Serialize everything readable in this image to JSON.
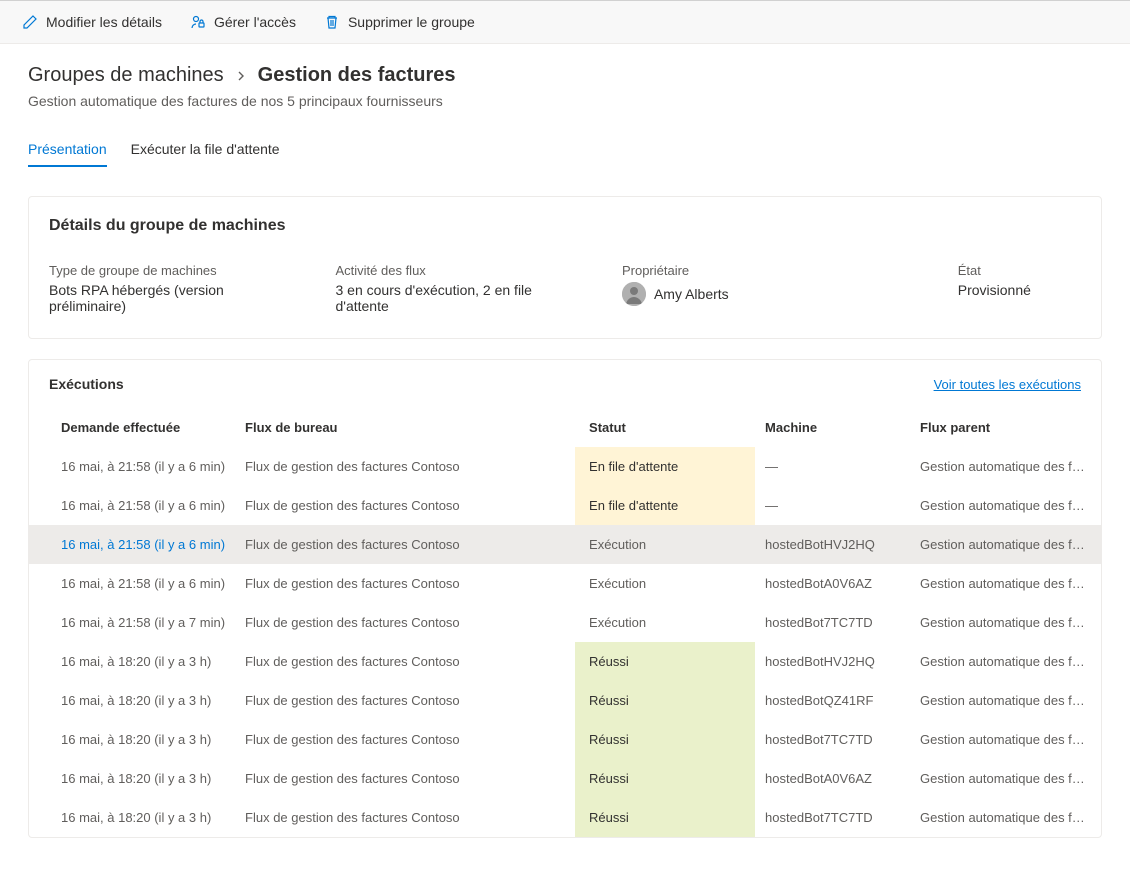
{
  "toolbar": {
    "edit_label": "Modifier les détails",
    "manage_access_label": "Gérer l'accès",
    "delete_label": "Supprimer le groupe"
  },
  "breadcrumb": {
    "parent": "Groupes de machines",
    "current": "Gestion des factures"
  },
  "page_subtitle": "Gestion automatique des factures de nos 5 principaux fournisseurs",
  "tabs": {
    "overview": "Présentation",
    "run_queue": "Exécuter la file d'attente"
  },
  "details_card": {
    "title": "Détails du groupe de machines",
    "type_label": "Type de groupe de machines",
    "type_value": "Bots RPA hébergés (version préliminaire)",
    "activity_label": "Activité des flux",
    "activity_value": "3 en cours d'exécution, 2 en file d'attente",
    "owner_label": "Propriétaire",
    "owner_value": "Amy Alberts",
    "state_label": "État",
    "state_value": "Provisionné"
  },
  "executions": {
    "title": "Exécutions",
    "see_all": "Voir toutes les exécutions",
    "columns": {
      "requested": "Demande effectuée",
      "desktop_flow": "Flux de bureau",
      "status": "Statut",
      "machine": "Machine",
      "parent_flow": "Flux parent"
    },
    "rows": [
      {
        "requested": "16 mai, à 21:58 (il y a 6 min)",
        "flow": "Flux de gestion des factures Contoso",
        "status": "En file d'attente",
        "status_kind": "queued",
        "machine": "—",
        "parent": "Gestion automatique des fact..."
      },
      {
        "requested": "16 mai, à 21:58 (il y a 6 min)",
        "flow": "Flux de gestion des factures Contoso",
        "status": "En file d'attente",
        "status_kind": "queued",
        "machine": "—",
        "parent": "Gestion automatique des fact..."
      },
      {
        "requested": "16 mai, à 21:58 (il y a 6 min)",
        "flow": "Flux de gestion des factures Contoso",
        "status": "Exécution",
        "status_kind": "running",
        "machine": "hostedBotHVJ2HQ",
        "parent": "Gestion automatique des fact...",
        "highlighted": true
      },
      {
        "requested": "16 mai, à 21:58 (il y a 6 min)",
        "flow": "Flux de gestion des factures Contoso",
        "status": "Exécution",
        "status_kind": "running",
        "machine": "hostedBotA0V6AZ",
        "parent": "Gestion automatique des fact..."
      },
      {
        "requested": "16 mai, à 21:58 (il y a 7 min)",
        "flow": "Flux de gestion des factures Contoso",
        "status": "Exécution",
        "status_kind": "running",
        "machine": "hostedBot7TC7TD",
        "parent": "Gestion automatique des fact..."
      },
      {
        "requested": "16 mai, à 18:20 (il y a 3 h)",
        "flow": "Flux de gestion des factures Contoso",
        "status": "Réussi",
        "status_kind": "success",
        "machine": "hostedBotHVJ2HQ",
        "parent": "Gestion automatique des fact..."
      },
      {
        "requested": "16 mai, à 18:20 (il y a 3 h)",
        "flow": "Flux de gestion des factures Contoso",
        "status": "Réussi",
        "status_kind": "success",
        "machine": "hostedBotQZ41RF",
        "parent": "Gestion automatique des fact..."
      },
      {
        "requested": "16 mai, à 18:20 (il y a 3 h)",
        "flow": "Flux de gestion des factures Contoso",
        "status": "Réussi",
        "status_kind": "success",
        "machine": "hostedBot7TC7TD",
        "parent": "Gestion automatique des fact..."
      },
      {
        "requested": "16 mai, à 18:20 (il y a 3 h)",
        "flow": "Flux de gestion des factures Contoso",
        "status": "Réussi",
        "status_kind": "success",
        "machine": "hostedBotA0V6AZ",
        "parent": "Gestion automatique des fact..."
      },
      {
        "requested": "16 mai, à 18:20 (il y a 3 h)",
        "flow": "Flux de gestion des factures Contoso",
        "status": "Réussi",
        "status_kind": "success",
        "machine": "hostedBot7TC7TD",
        "parent": "Gestion automatique des fact..."
      }
    ]
  }
}
